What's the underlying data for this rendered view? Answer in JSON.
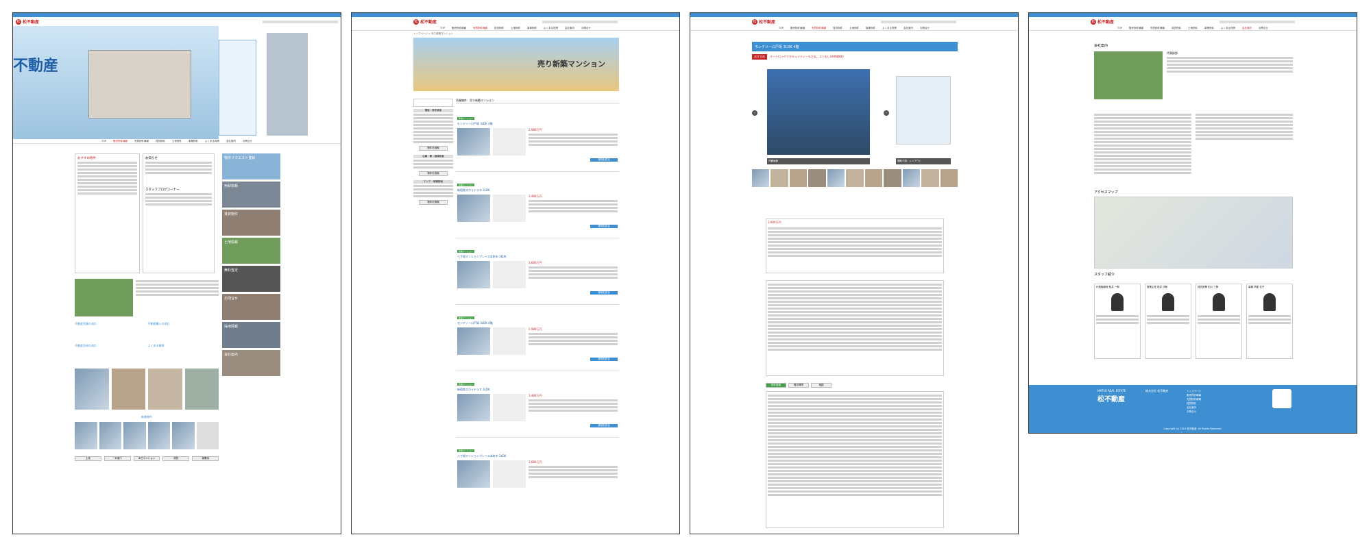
{
  "site": {
    "name": "松不動産",
    "name_en": "MATSU REAL ESTATE",
    "nav": [
      "TOP",
      "販売物件情報",
      "売買物件情報",
      "賃貸物件",
      "土地物件",
      "事業物件",
      "よくある質問",
      "会社案内",
      "お問合せ"
    ]
  },
  "p1": {
    "hero_text": "不動産",
    "news_title": "お知らせ",
    "blog_title": "スタッフブログコーナー",
    "side_banners": [
      "物件リクエスト登録",
      "売却依頼",
      "賃貸物件",
      "土地情報",
      "無料査定",
      "お問合せ",
      "採用情報",
      "会社案内"
    ],
    "recommend_title": "おすすめ物件",
    "new_title": "新着物件",
    "flow_titles": [
      "不動産売買の流れ",
      "不動産購入の流れ",
      "不動産売却の流れ",
      "よくある質問"
    ],
    "search_buttons": [
      "土地",
      "一戸建て",
      "中古マンション",
      "賃貸",
      "事業用"
    ]
  },
  "p2": {
    "banner": "売り新築マンション",
    "breadcrumb": "トップページ > 売り新築マンション",
    "section_title": "売買物件：売り新築マンション",
    "side_headers": [
      "間取・条件検索",
      "沿線・駅・路線検索",
      "エリア・価格検索"
    ],
    "search_label": "物件を検索",
    "listings": [
      {
        "badge": "新築マンション",
        "title": "モンテソーロ戸塚 3LDK 4階",
        "price": "2,980万円",
        "detail": "詳細を見る"
      },
      {
        "badge": "新築マンション",
        "title": "新宿南スカイテラス 3LDK",
        "price": "3,480万円",
        "detail": "詳細を見る"
      },
      {
        "badge": "新築マンション",
        "title": "八丁堀マンションプレイス本町市 3LDK",
        "price": "3,680万円",
        "detail": "詳細を見る"
      },
      {
        "badge": "新築マンション",
        "title": "モンテソーロ戸塚 3LDK 4階",
        "price": "2,980万円",
        "detail": "詳細を見る"
      },
      {
        "badge": "新築マンション",
        "title": "新宿南スカイテラス 3LDK",
        "price": "3,480万円",
        "detail": "詳細を見る"
      },
      {
        "badge": "新築マンション",
        "title": "八丁堀マンションプレイス本町市 3LDK",
        "price": "3,680万円",
        "detail": "詳細を見る"
      }
    ]
  },
  "p3": {
    "title": "モンテソーロ戸塚 3LDK 4階",
    "price": "2,980万円",
    "recommend": "おすすめ",
    "catch": "オートロックでセキュリティーも万全。ゴミ出し24時間OK！",
    "thumb_left": "外観画像",
    "thumb_right": "間取り図・レイアウト",
    "tabs": [
      "物件詳細",
      "周辺環境",
      "地図"
    ],
    "contact": "お問合せ"
  },
  "p4": {
    "company_title": "会社案内",
    "greeting": "代表挨拶",
    "access_title": "アクセスマップ",
    "staff_title": "スタッフ紹介",
    "staff": [
      "代表取締役 松井 一郎",
      "営業主任 松井 次郎",
      "賃貸営業 田川 三郎",
      "事務 芦屋 花子"
    ],
    "footer_name": "株式会社 松不動産",
    "footer_links": [
      "トップページ",
      "販売物件情報",
      "売買物件情報",
      "賃貸物件",
      "会社案内",
      "お問合せ"
    ],
    "copyright": "Copyright (c) 2015 松不動産. All Rights Reserved."
  }
}
